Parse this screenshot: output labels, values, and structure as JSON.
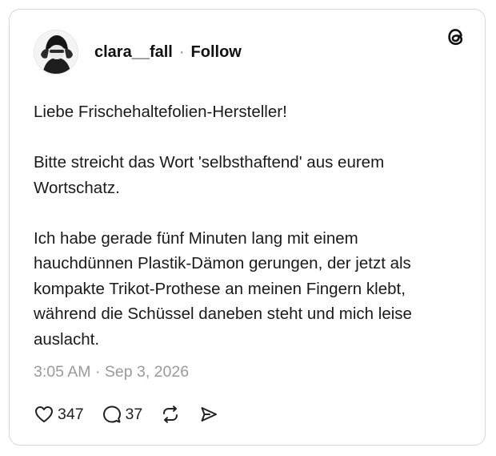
{
  "post": {
    "author": {
      "username": "clara__fall",
      "separator": "·",
      "follow_label": "Follow",
      "avatar_icon": "user-avatar-icon"
    },
    "brand_icon": "threads-logo-icon",
    "paragraphs": [
      "Liebe Frischehaltefolien-Hersteller!",
      "Bitte streicht das Wort 'selbsthaftend' aus eurem Wortschatz.",
      "Ich habe gerade fünf Minuten lang mit einem hauchdünnen Plastik-Dämon gerungen, der jetzt als kompakte Trikot-Prothese an meinen Fingern klebt, während die Schüssel daneben steht und mich leise auslacht."
    ],
    "timestamp": "3:05 AM · Sep 3, 2026",
    "actions": {
      "like_count": "347",
      "reply_count": "37",
      "like_icon": "heart-icon",
      "reply_icon": "comment-icon",
      "repost_icon": "repost-icon",
      "share_icon": "share-icon"
    }
  },
  "colors": {
    "text": "#111111",
    "muted": "#9a9a9a",
    "border": "#d8d8d8",
    "background": "#ffffff"
  }
}
